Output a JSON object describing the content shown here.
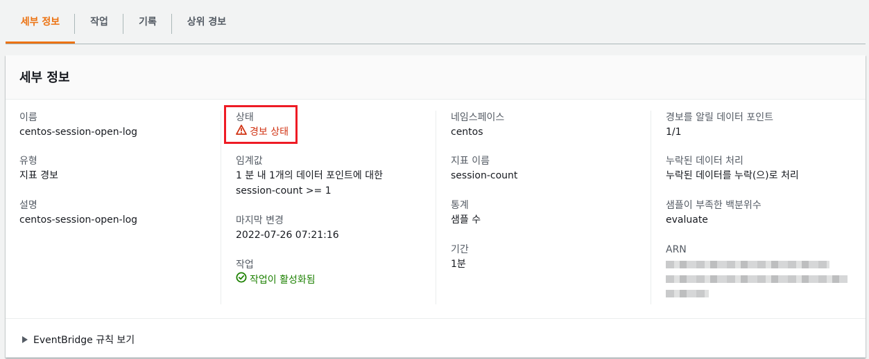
{
  "tabs": [
    {
      "label": "세부 정보",
      "active": true
    },
    {
      "label": "작업",
      "active": false
    },
    {
      "label": "기록",
      "active": false
    },
    {
      "label": "상위 경보",
      "active": false
    }
  ],
  "panel": {
    "title": "세부 정보",
    "col1": [
      {
        "label": "이름",
        "value": "centos-session-open-log"
      },
      {
        "label": "유형",
        "value": "지표 경보"
      },
      {
        "label": "설명",
        "value": "centos-session-open-log"
      }
    ],
    "col2": {
      "state": {
        "label": "상태",
        "value": "경보 상태",
        "icon": "warning-triangle-icon",
        "color": "#d13212"
      },
      "threshold": {
        "label": "임계값",
        "line1": "1 분 내 1개의 데이터 포인트에 대한",
        "line2": "session-count >= 1"
      },
      "last_change": {
        "label": "마지막 변경",
        "value": "2022-07-26 07:21:16"
      },
      "actions": {
        "label": "작업",
        "value": "작업이 활성화됨",
        "icon": "check-circle-icon",
        "color": "#1d8102"
      }
    },
    "col3": [
      {
        "label": "네임스페이스",
        "value": "centos"
      },
      {
        "label": "지표 이름",
        "value": "session-count"
      },
      {
        "label": "통계",
        "value": "샘플 수"
      },
      {
        "label": "기간",
        "value": "1분"
      }
    ],
    "col4": [
      {
        "label": "경보를 알릴 데이터 포인트",
        "value": "1/1"
      },
      {
        "label": "누락된 데이터 처리",
        "value": "누락된 데이터를 누락(으)로 처리"
      },
      {
        "label": "샘플이 부족한 백분위수",
        "value": "evaluate"
      },
      {
        "label": "ARN",
        "value": ""
      }
    ],
    "footer": {
      "expander_label": "EventBridge 규칙 보기"
    }
  },
  "colors": {
    "accent": "#ec7211",
    "alarm": "#d13212",
    "ok": "#1d8102",
    "highlight": "#ee1b24"
  }
}
